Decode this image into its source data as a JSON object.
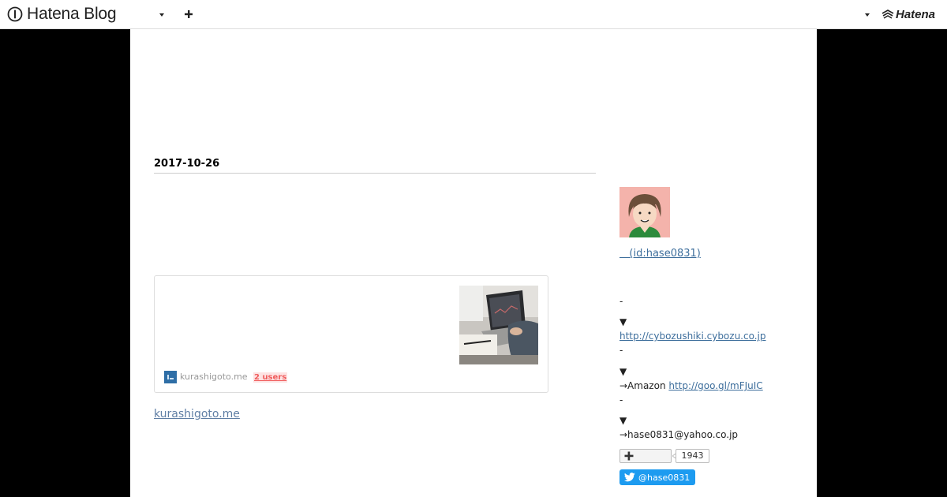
{
  "header": {
    "brand": "Hatena Blog",
    "right_brand": "Hatena"
  },
  "entry": {
    "date": "2017-10-26",
    "embed": {
      "site": "kurashigoto.me",
      "users": "2 users"
    },
    "source_link": "kurashigoto.me"
  },
  "sidebar": {
    "profile_name": "   (id:hase0831)",
    "dash1": "-",
    "arrow1": "▼",
    "link1": "http://cybozushiki.cybozu.co.jp",
    "dash2": "-",
    "arrow2": "▼",
    "amazon_prefix": "→Amazon ",
    "link2": "http://goo.gl/mFJuIC",
    "dash3": "-",
    "arrow3": "▼",
    "email": "→hase0831@yahoo.co.jp",
    "follow_count": "1943",
    "twitter_handle": "@hase0831"
  },
  "colors": {
    "page_bg": "#000000",
    "link": "#3d6e9c",
    "twitter": "#1d9bf0",
    "users_badge": "#f05c5c"
  },
  "icons": [
    "hatena-blog-logo-icon",
    "chevron-down-icon",
    "plus-icon",
    "hatena-logo-icon",
    "twitter-bird-icon",
    "site-favicon-icon"
  ]
}
